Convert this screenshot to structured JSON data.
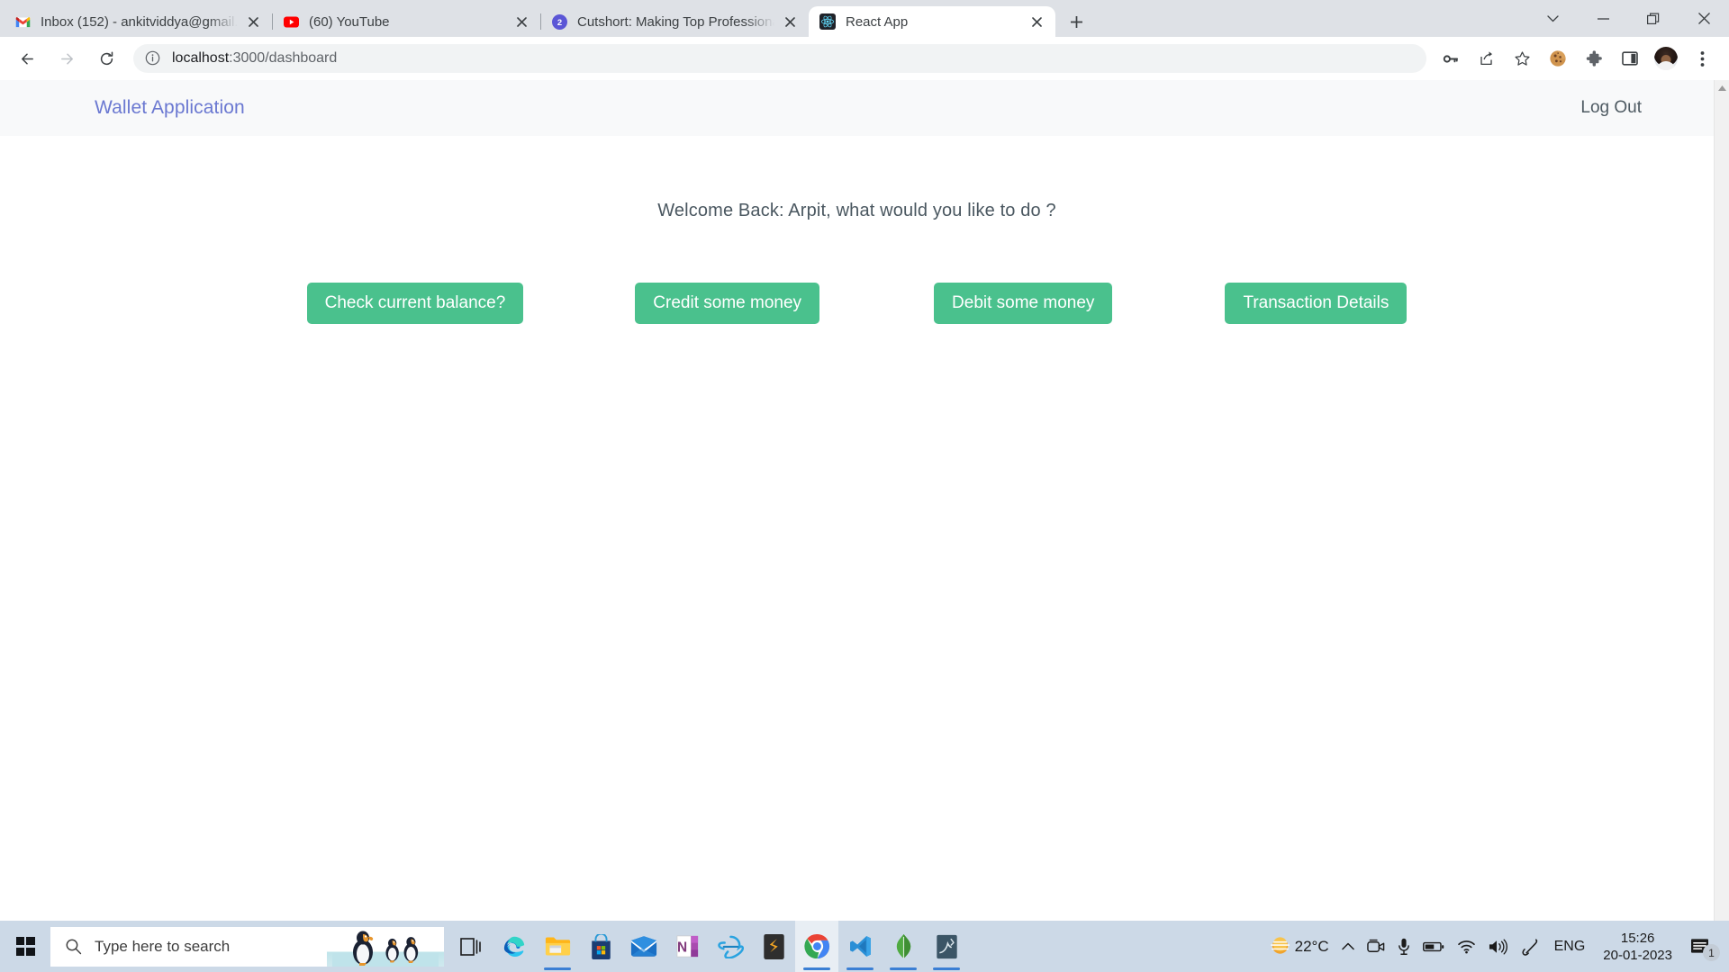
{
  "browser": {
    "tabs": [
      {
        "title": "Inbox (152) - ankitviddya@gmail.",
        "favicon": "gmail-icon",
        "active": false,
        "badge": ""
      },
      {
        "title": "(60) YouTube",
        "favicon": "youtube-icon",
        "active": false,
        "badge": ""
      },
      {
        "title": "Cutshort: Making Top Professiona",
        "favicon": "cutshort-icon",
        "active": false,
        "badge": "2"
      },
      {
        "title": "React App",
        "favicon": "react-icon",
        "active": true,
        "badge": ""
      }
    ],
    "newtab_label": "+",
    "window_controls": {
      "tab_search": "chevron-down-icon",
      "minimize": "minimize-icon",
      "maximize": "restore-icon",
      "close": "close-icon"
    },
    "toolbar": {
      "back": "back-arrow-icon",
      "forward": "forward-arrow-icon",
      "reload": "reload-icon",
      "site_info": "info-circle-icon",
      "url_host": "localhost",
      "url_rest": ":3000/dashboard",
      "url_full": "localhost:3000/dashboard",
      "actions": [
        "password-key-icon",
        "share-icon",
        "bookmark-star-icon",
        "cookie-icon",
        "extensions-puzzle-icon",
        "side-panel-icon"
      ],
      "profile": "avatar",
      "menu": "three-dot-menu-icon"
    }
  },
  "app": {
    "brand": "Wallet Application",
    "brand_color": "#6a78d1",
    "logout_label": "Log Out",
    "welcome": "Welcome Back: Arpit, what would you like to do ?",
    "button_color": "#4ac18d",
    "buttons": [
      {
        "label": "Check current balance?"
      },
      {
        "label": "Credit some money"
      },
      {
        "label": "Debit some money"
      },
      {
        "label": "Transaction Details"
      }
    ]
  },
  "taskbar": {
    "start": "windows-start-icon",
    "search_placeholder": "Type here to search",
    "search_icon": "search-icon",
    "wallpaper_thumb": "penguins-image",
    "icons": [
      {
        "name": "task-view-icon",
        "running": false,
        "active": false
      },
      {
        "name": "microsoft-edge-icon",
        "running": false,
        "active": false
      },
      {
        "name": "file-explorer-icon",
        "running": true,
        "active": false
      },
      {
        "name": "microsoft-store-icon",
        "running": false,
        "active": false
      },
      {
        "name": "mail-icon",
        "running": false,
        "active": false
      },
      {
        "name": "onenote-icon",
        "running": false,
        "active": false
      },
      {
        "name": "internet-explorer-icon",
        "running": false,
        "active": false
      },
      {
        "name": "sublime-text-icon",
        "running": false,
        "active": false
      },
      {
        "name": "google-chrome-icon",
        "running": true,
        "active": true
      },
      {
        "name": "vs-code-icon",
        "running": true,
        "active": false
      },
      {
        "name": "mongodb-compass-icon",
        "running": true,
        "active": false
      },
      {
        "name": "mysql-workbench-icon",
        "running": true,
        "active": false
      }
    ],
    "tray": {
      "weather_icon": "weather-sun-icon",
      "temperature": "22°C",
      "show_hidden": "chevron-up-icon",
      "items": [
        "camera-icon",
        "microphone-icon",
        "battery-icon",
        "wifi-icon",
        "volume-icon",
        "pen-ink-icon"
      ],
      "language": "ENG",
      "time": "15:26",
      "date": "20-01-2023",
      "notification_icon": "notification-icon",
      "notification_count": "1"
    }
  }
}
